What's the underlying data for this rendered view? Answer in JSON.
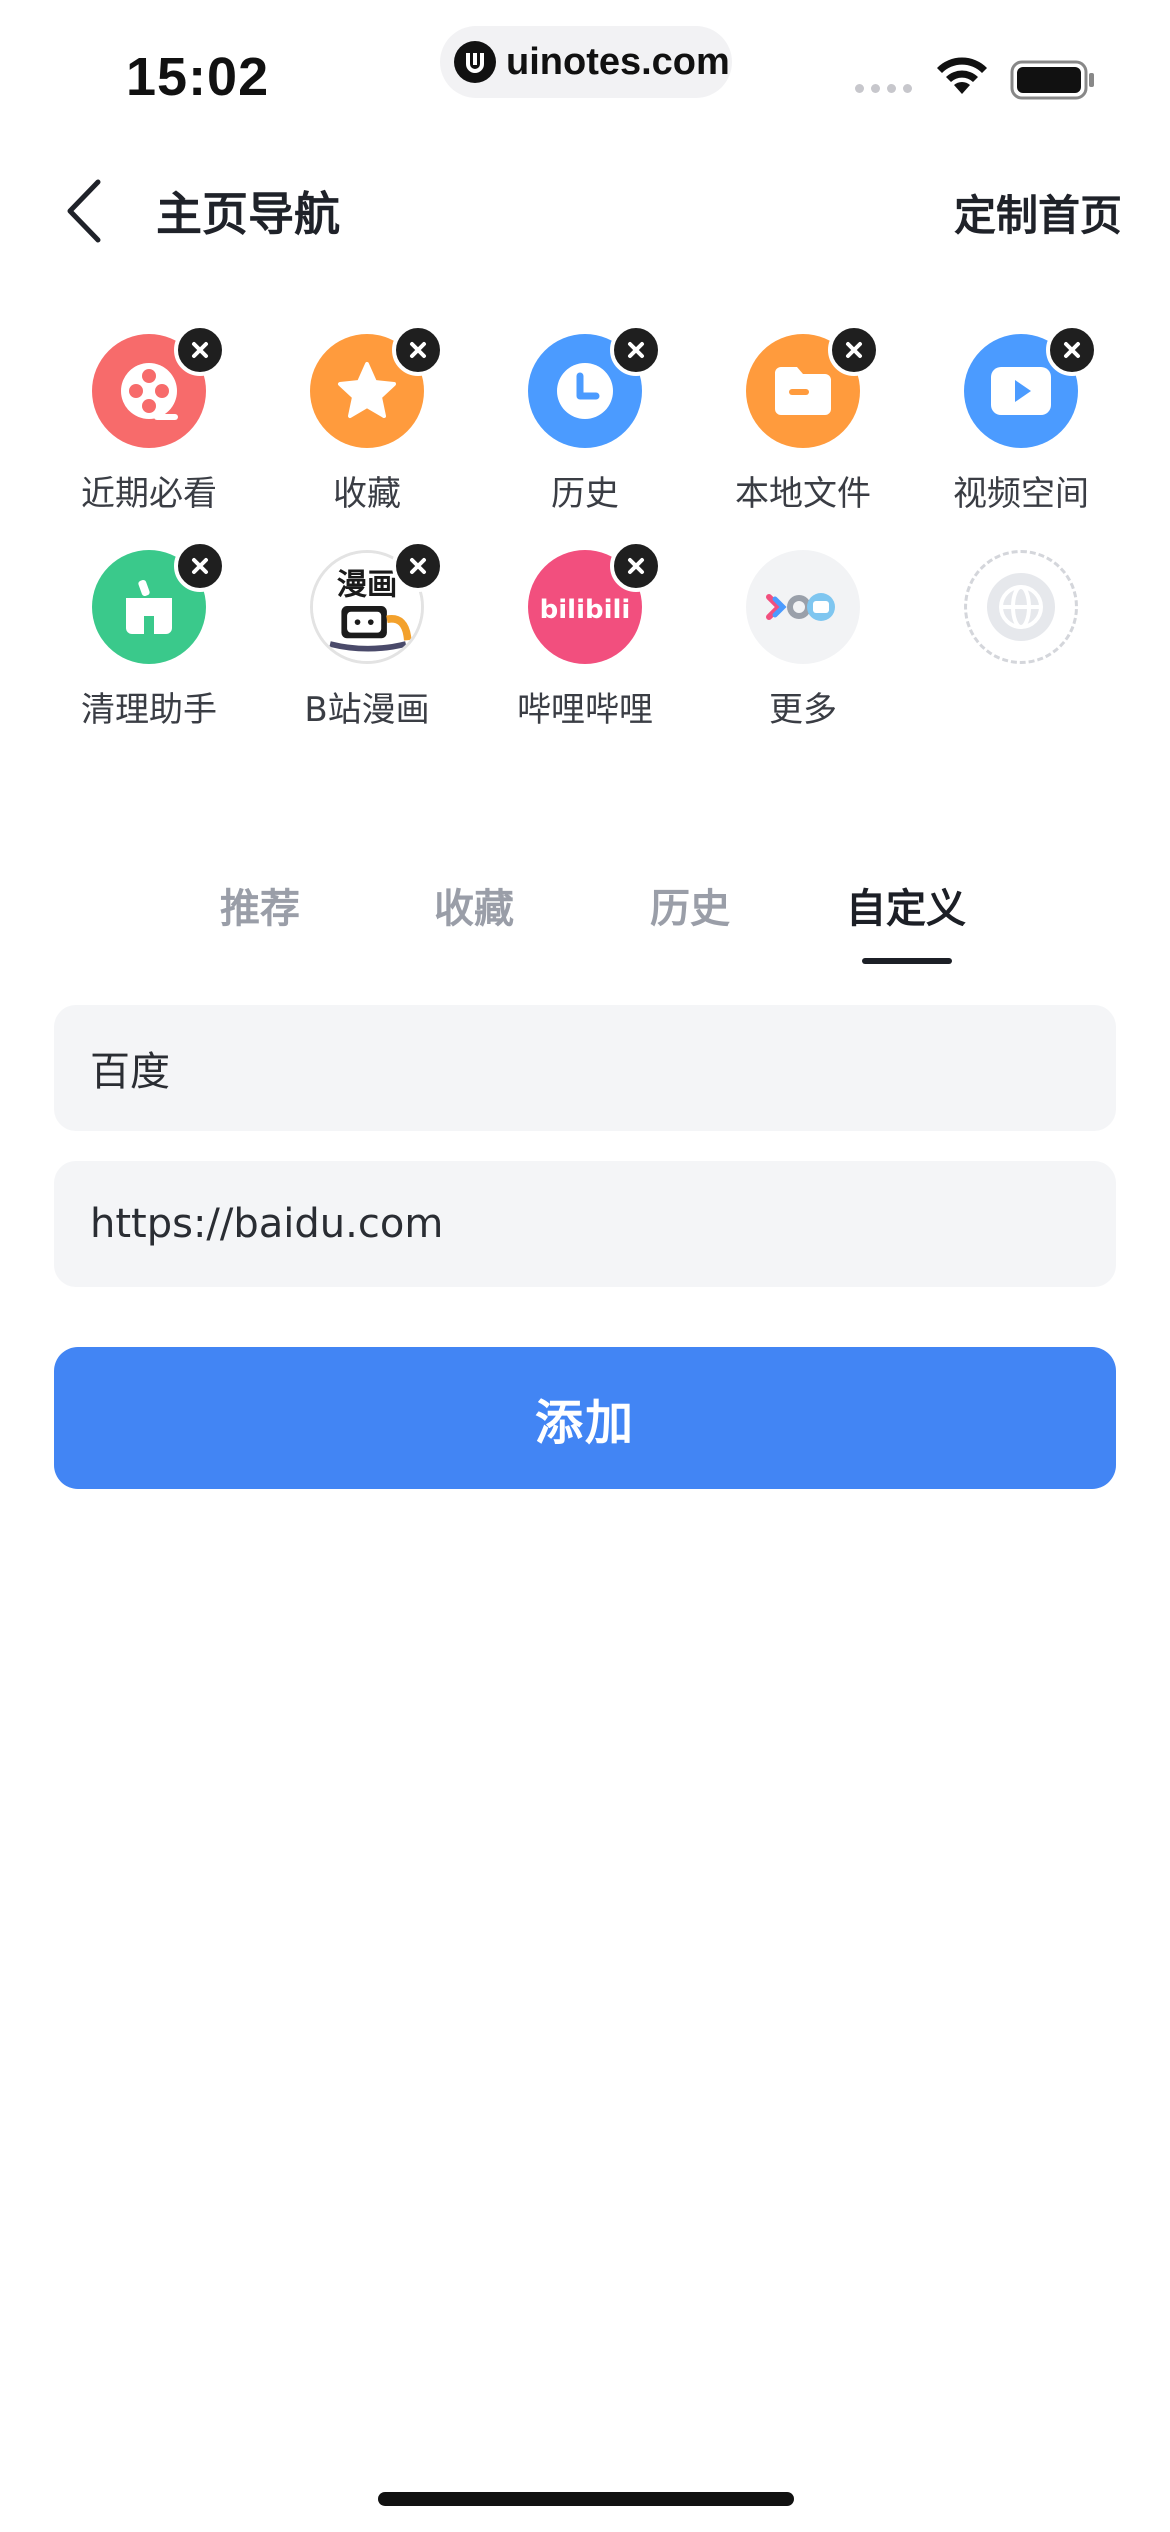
{
  "status_bar": {
    "time": "15:02",
    "url": "uinotes.com"
  },
  "nav": {
    "title": "主页导航",
    "action": "定制首页"
  },
  "shortcuts": [
    {
      "label": "近期必看",
      "icon": "film-reel-icon",
      "color": "#f76b6b"
    },
    {
      "label": "收藏",
      "icon": "star-icon",
      "color": "#ff9b3d"
    },
    {
      "label": "历史",
      "icon": "clock-icon",
      "color": "#4b9bff"
    },
    {
      "label": "本地文件",
      "icon": "folder-icon",
      "color": "#ff9b3d"
    },
    {
      "label": "视频空间",
      "icon": "play-icon",
      "color": "#4b9bff"
    },
    {
      "label": "清理助手",
      "icon": "broom-icon",
      "color": "#3ac98b"
    },
    {
      "label": "B站漫画",
      "icon": "manga-icon",
      "color": "#ffffff",
      "glyph": "漫画"
    },
    {
      "label": "哔哩哔哩",
      "icon": "bilibili-icon",
      "color": "#f24f7e",
      "glyph": "bilibili"
    },
    {
      "label": "更多",
      "icon": "more-apps-icon",
      "color": "#f2f3f5"
    }
  ],
  "tabs": [
    {
      "label": "推荐",
      "active": false
    },
    {
      "label": "收藏",
      "active": false
    },
    {
      "label": "历史",
      "active": false
    },
    {
      "label": "自定义",
      "active": true
    }
  ],
  "form": {
    "name_value": "百度",
    "url_value": "https://baidu.com",
    "submit_label": "添加"
  },
  "colors": {
    "accent": "#4285f4",
    "field_bg": "#f4f5f7"
  }
}
